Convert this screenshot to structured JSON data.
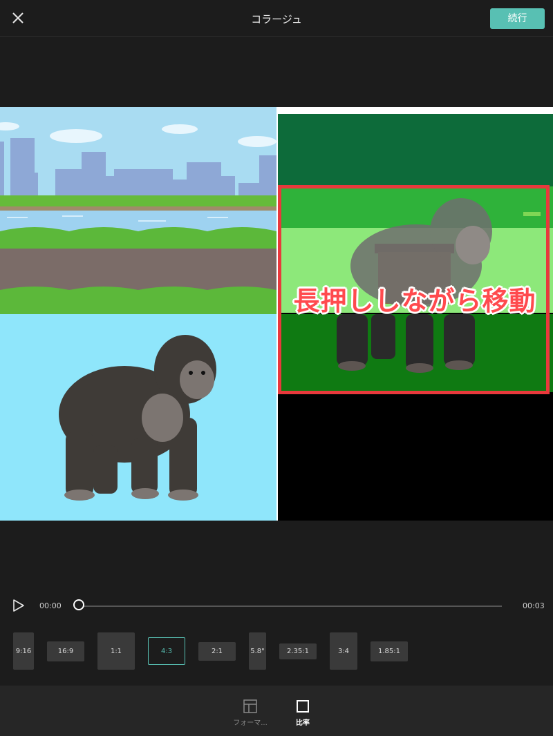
{
  "header": {
    "title": "コラージュ",
    "continue_label": "続行"
  },
  "canvas": {
    "instruction_label": "長押ししながら移動"
  },
  "timeline": {
    "current_time": "00:00",
    "total_time": "00:03",
    "progress": 0
  },
  "ratios": [
    {
      "label": "9:16"
    },
    {
      "label": "16:9"
    },
    {
      "label": "1:1"
    },
    {
      "label": "4:3",
      "selected": true
    },
    {
      "label": "2:1"
    },
    {
      "label": "5.8\""
    },
    {
      "label": "2.35:1"
    },
    {
      "label": "3:4"
    },
    {
      "label": "1.85:1"
    }
  ],
  "bottom_tabs": [
    {
      "label": "フォーマ...",
      "icon": "layout-icon"
    },
    {
      "label": "比率",
      "icon": "ratio-square-icon",
      "active": true
    }
  ],
  "colors": {
    "accent": "#58c0b3",
    "highlight_red": "#e8393c",
    "background": "#1c1c1c"
  }
}
